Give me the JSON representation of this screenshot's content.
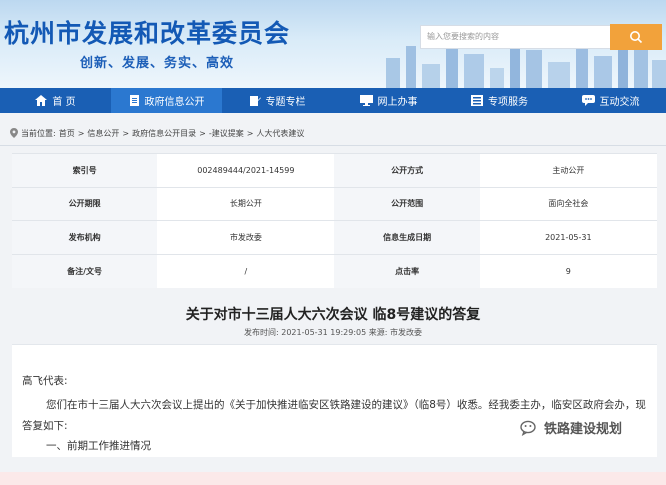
{
  "header": {
    "site_title": "杭州市发展和改革委员会",
    "slogan": "创新、发展、务实、高效",
    "search_placeholder": "输入您要搜索的内容"
  },
  "nav": {
    "items": [
      {
        "label": "首 页",
        "icon": "home-icon"
      },
      {
        "label": "政府信息公开",
        "icon": "document-icon"
      },
      {
        "label": "专题专栏",
        "icon": "edit-icon"
      },
      {
        "label": "网上办事",
        "icon": "monitor-icon"
      },
      {
        "label": "专项服务",
        "icon": "list-icon"
      },
      {
        "label": "互动交流",
        "icon": "chat-icon"
      }
    ],
    "active_index": 1
  },
  "breadcrumb": {
    "prefix": "当前位置:",
    "items": [
      "首页",
      "信息公开",
      "政府信息公开目录",
      "-建议提案",
      "人大代表建议"
    ],
    "separator": ">"
  },
  "info": {
    "rows": [
      [
        {
          "k": "索引号",
          "v": "002489444/2021-14599"
        },
        {
          "k": "公开方式",
          "v": "主动公开"
        }
      ],
      [
        {
          "k": "公开期限",
          "v": "长期公开"
        },
        {
          "k": "公开范围",
          "v": "面向全社会"
        }
      ],
      [
        {
          "k": "发布机构",
          "v": "市发改委"
        },
        {
          "k": "信息生成日期",
          "v": "2021-05-31"
        }
      ],
      [
        {
          "k": "备注/文号",
          "v": "/"
        },
        {
          "k": "点击率",
          "v": "9"
        }
      ]
    ]
  },
  "doc": {
    "title": "关于对市十三届人大六次会议 临8号建议的答复",
    "meta": "发布时间: 2021-05-31 19:29:05   来源: 市发改委",
    "salutation": "高飞代表:",
    "paragraph": "您们在市十三届人大六次会议上提出的《关于加快推进临安区铁路建设的建议》（临8号）收悉。经我委主办，临安区政府会办，现答复如下:",
    "section": "一、前期工作推进情况"
  },
  "watermark": {
    "text": "铁路建设规划"
  },
  "colors": {
    "brand": "#1a5fb4",
    "search_button": "#f2a23b"
  }
}
